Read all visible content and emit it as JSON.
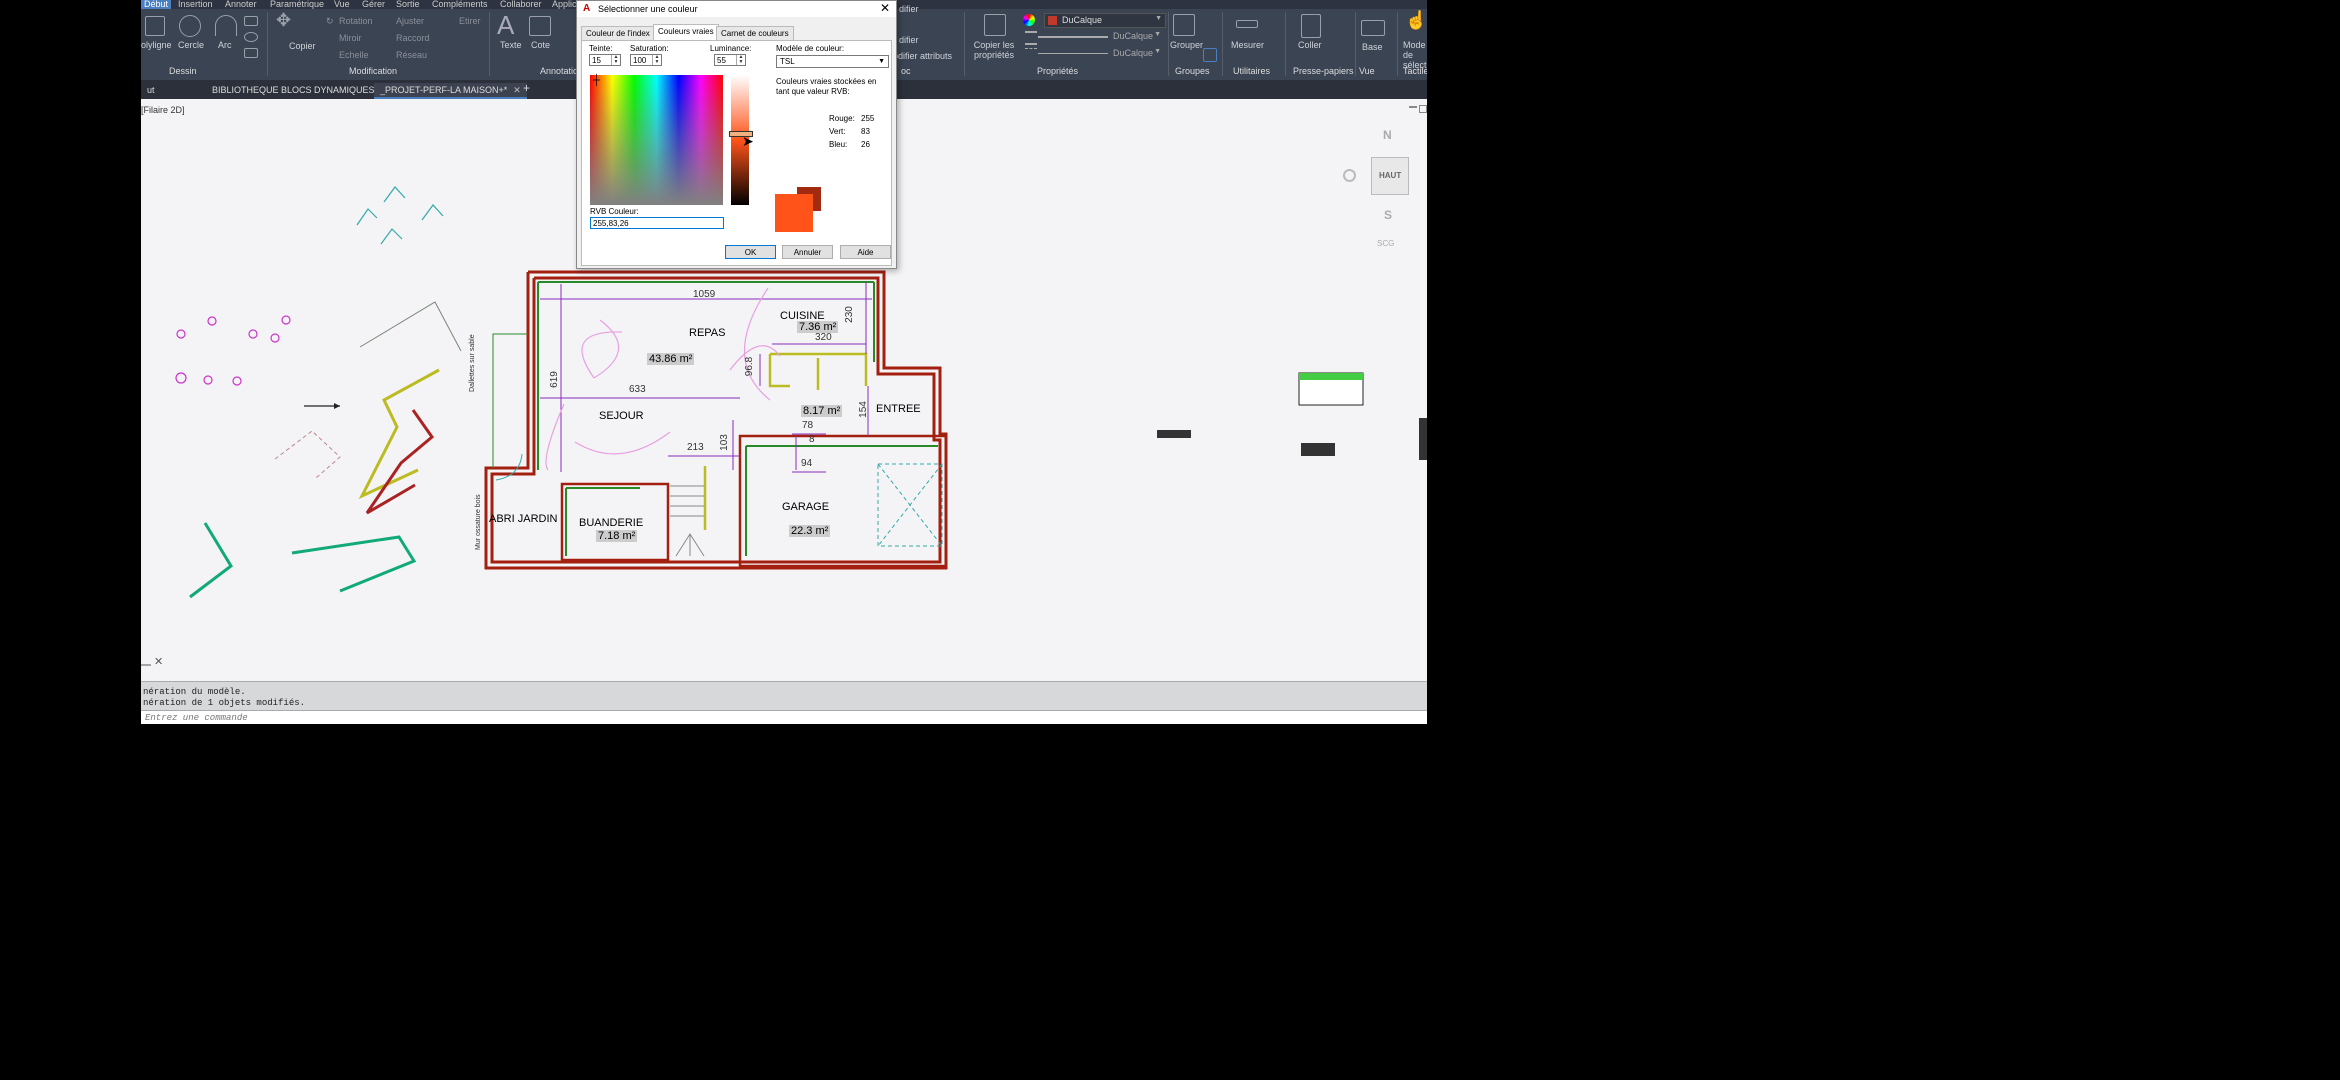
{
  "ribbon": {
    "tabs": [
      "Début",
      "Insertion",
      "Annoter",
      "Paramétrique",
      "Vue",
      "Gérer",
      "Sortie",
      "Compléments",
      "Collaborer",
      "Applic"
    ],
    "draw_tools": [
      "olyligne",
      "Cercle",
      "Arc"
    ],
    "modify_tools": [
      "Rotation",
      "Ajuster",
      "Etirer",
      "Miroir",
      "Raccord",
      "Echelle",
      "Réseau",
      "Copier"
    ],
    "annotation_tools": [
      "Texte",
      "Cote"
    ],
    "annotation_title": "Annotatio",
    "block_tools": [
      "Copier les propriétés",
      "odifier attributs",
      "difier"
    ],
    "block_title": "oc",
    "layer_props": [
      "DuCalque",
      "DuCalque",
      "DuCalque"
    ],
    "groups_label": "Grouper",
    "util_label": "Mesurer",
    "paste_label": "Coller",
    "base_label": "Base",
    "select_label": "Mode de sélection",
    "panels": [
      "Dessin",
      "Modification",
      "Propriétés",
      "Groupes",
      "Utilitaires",
      "Presse-papiers",
      "Vue",
      "Tactile"
    ]
  },
  "filetabs": {
    "first": "ut",
    "tab1": "BIBLIOTHEQUE BLOCS DYNAMIQUES",
    "tab2": "_PROJET-PERF-LA MAISON+*",
    "plus": "+"
  },
  "canvas": {
    "view_label": "[Filaire 2D]",
    "viewcube": {
      "n": "N",
      "s": "S",
      "top": "HAUT",
      "scg": "SCG"
    }
  },
  "plan": {
    "rooms": [
      {
        "name": "CUISINE",
        "area": "7.36 m²"
      },
      {
        "name": "REPAS",
        "area": "43.86 m²"
      },
      {
        "name": "SEJOUR",
        "area": ""
      },
      {
        "name": "ENTREE",
        "area": "8.17 m²"
      },
      {
        "name": "GARAGE",
        "area": "22.3 m²"
      },
      {
        "name": "BUANDERIE",
        "area": "7.18 m²"
      },
      {
        "name": "ABRI JARDIN",
        "area": ""
      }
    ],
    "dims": [
      "1059",
      "230",
      "320",
      "96.8",
      "619",
      "633",
      "154",
      "78",
      "213",
      "103",
      "94",
      "8"
    ],
    "side_labels": [
      "Dallettes sur sable",
      "Mur ossature bois"
    ]
  },
  "command": {
    "line1": "nération du modèle.",
    "line2": "nération de 1 objets modifiés.",
    "placeholder": "Entrez une commande"
  },
  "dialog": {
    "title": "Sélectionner une couleur",
    "tabs": [
      "Couleur de l'index",
      "Couleurs vraies",
      "Carnet de couleurs"
    ],
    "hue_label": "Teinte:",
    "hue": "15",
    "sat_label": "Saturation:",
    "sat": "100",
    "lum_label": "Luminance:",
    "lum": "55",
    "model_label": "Modèle de couleur:",
    "model": "TSL",
    "info": "Couleurs vraies stockées en tant que valeur RVB:",
    "red_label": "Rouge:",
    "red": "255",
    "green_label": "Vert:",
    "green": "83",
    "blue_label": "Bleu:",
    "blue": "26",
    "rgb_label": "RVB Couleur:",
    "rgb": "255,83,26",
    "ok": "OK",
    "cancel": "Annuler",
    "help": "Aide",
    "new_color": "#ff531a",
    "old_color": "#a12a10"
  }
}
